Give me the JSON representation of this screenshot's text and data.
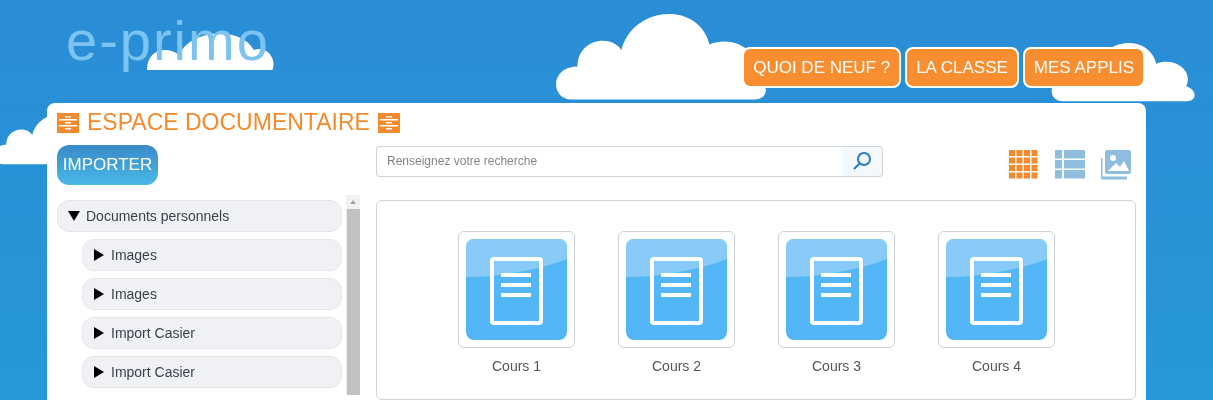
{
  "logo": "e-primo",
  "nav": [
    {
      "label": "QUOI DE NEUF ?"
    },
    {
      "label": "LA CLASSE"
    },
    {
      "label": "MES APPLIS"
    }
  ],
  "title": "ESPACE DOCUMENTAIRE",
  "import_button": "IMPORTER",
  "search": {
    "placeholder": "Renseignez votre recherche"
  },
  "view_modes": [
    {
      "kind": "grid",
      "selected": true
    },
    {
      "kind": "list",
      "selected": false
    },
    {
      "kind": "gallery",
      "selected": false
    }
  ],
  "tree": [
    {
      "label": "Documents personnels",
      "expanded": true,
      "children": [
        {
          "label": "Images",
          "expanded": false
        },
        {
          "label": "Images",
          "expanded": false
        },
        {
          "label": "Import Casier",
          "expanded": false
        },
        {
          "label": "Import Casier",
          "expanded": false
        }
      ]
    }
  ],
  "files": [
    {
      "name": "Cours 1"
    },
    {
      "name": "Cours 2"
    },
    {
      "name": "Cours 3"
    },
    {
      "name": "Cours 4"
    }
  ]
}
